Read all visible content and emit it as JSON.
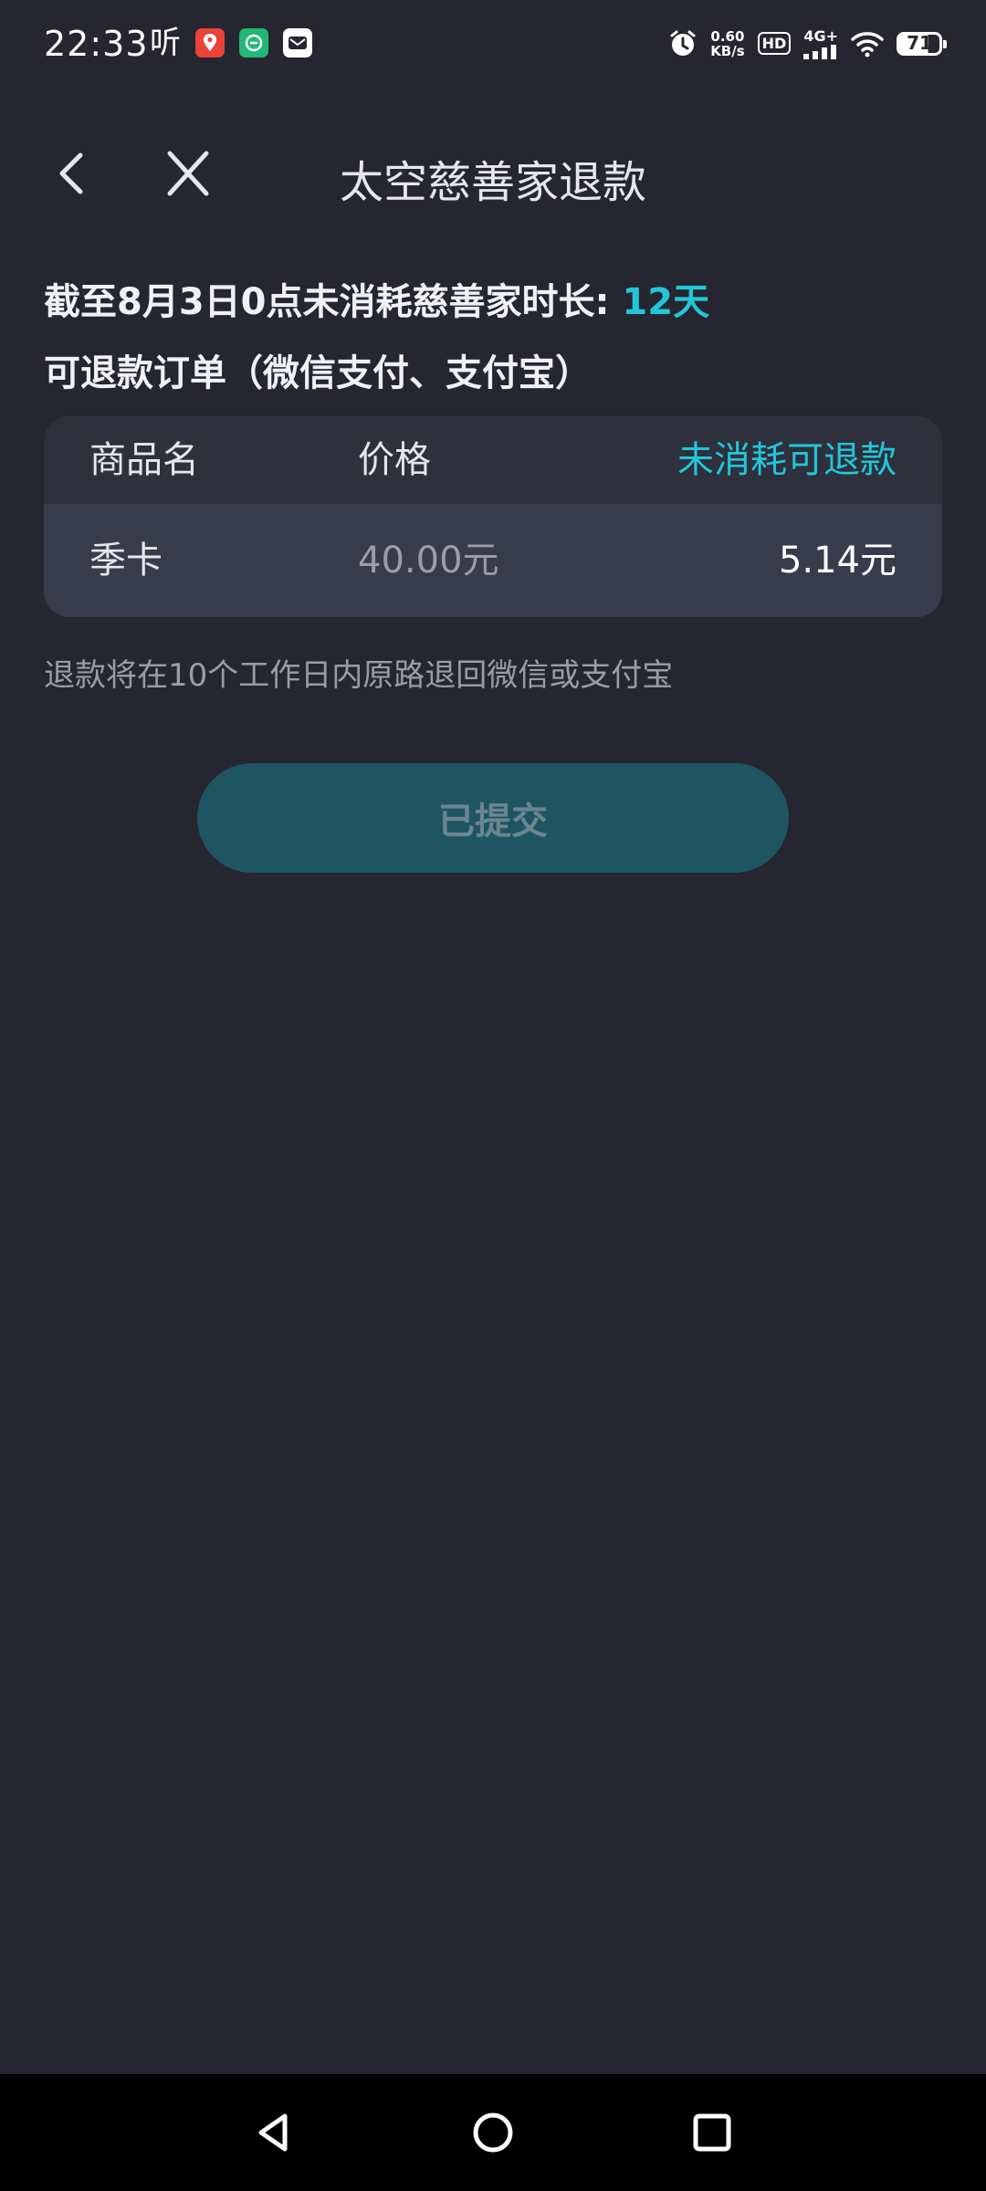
{
  "status_bar": {
    "time": "22:33",
    "ting": "听",
    "app_icons": [
      {
        "name": "map-pin-app-icon",
        "color": "#e8443a"
      },
      {
        "name": "green-app-icon",
        "color": "#21b878"
      },
      {
        "name": "envelope-app-icon",
        "color": "#ffffff"
      }
    ],
    "net_speed_value": "0.60",
    "net_speed_unit": "KB/s",
    "hd": "HD",
    "network": "4G+",
    "battery": "71"
  },
  "header": {
    "title": "太空慈善家退款"
  },
  "summary": {
    "text": "截至8月3日0点未消耗慈善家时长: ",
    "days": "12天"
  },
  "orders_label": "可退款订单（微信支付、支付宝）",
  "table": {
    "columns": [
      "商品名",
      "价格",
      "未消耗可退款"
    ],
    "rows": [
      {
        "name": "季卡",
        "price": "40.00元",
        "refund": "5.14元"
      }
    ]
  },
  "note": "退款将在10个工作日内原路退回微信或支付宝",
  "submit_label": "已提交",
  "colors": {
    "background": "#252630",
    "accent": "#22c6d8",
    "button": "#1f5561"
  }
}
